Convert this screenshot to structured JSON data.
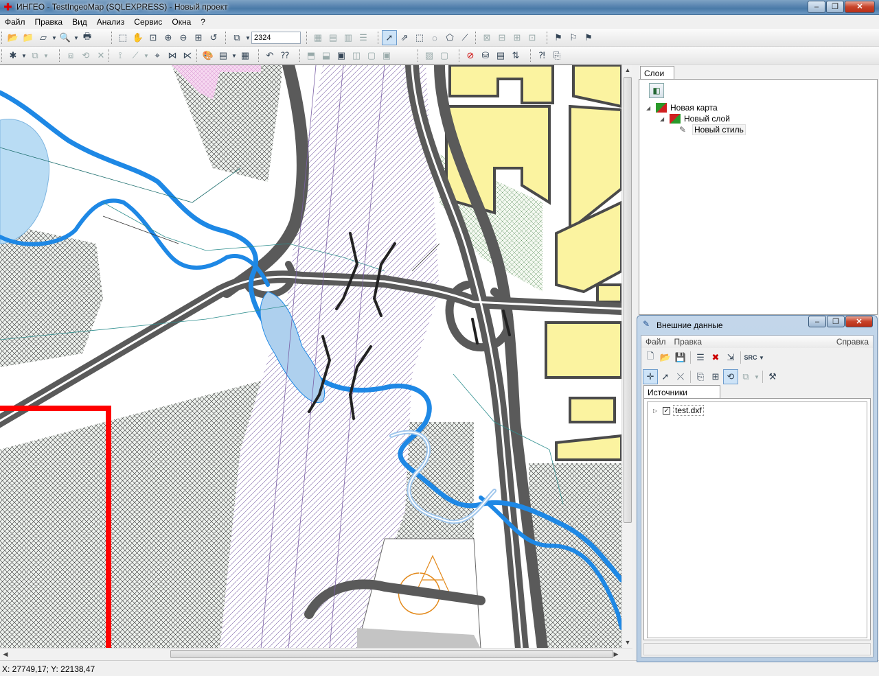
{
  "window": {
    "title": "ИНГЕО - TestIngeoMap (SQLEXPRESS) - Новый проект",
    "minimize": "–",
    "maximize": "❐",
    "close": "✕"
  },
  "menu": [
    "Файл",
    "Правка",
    "Вид",
    "Анализ",
    "Сервис",
    "Окна",
    "?"
  ],
  "toolbar": {
    "zoom_value": "2324"
  },
  "status": {
    "coords": "X: 27749,17; Y: 22138,47"
  },
  "layers_panel": {
    "tab": "Слои",
    "tree": {
      "map": "Новая карта",
      "layer": "Новый слой",
      "style": "Новый стиль"
    }
  },
  "external_data": {
    "title": "Внешние данные",
    "menu": {
      "file": "Файл",
      "edit": "Правка",
      "help": "Справка"
    },
    "tab": "Источники данных",
    "sources": [
      {
        "name": "test.dxf",
        "checked": true
      }
    ]
  },
  "colors": {
    "road": "#5a5a5a",
    "water": "#1e88e5",
    "water_fill": "#aed0ee",
    "building": "#fbf3a0",
    "boundary": "#ff0000",
    "zone_pink": "#f2c6ec"
  },
  "icons": {
    "app": "ingeo-logo-icon",
    "ext_window": "external-data-icon"
  }
}
